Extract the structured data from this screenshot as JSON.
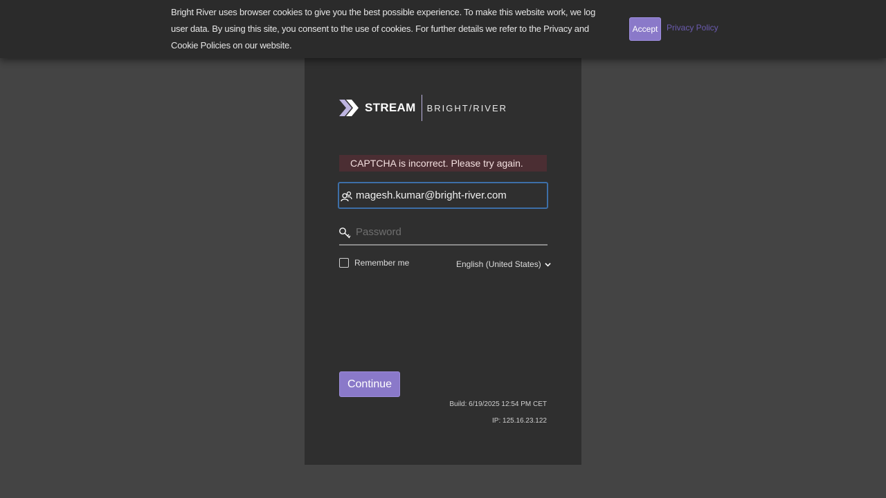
{
  "cookie_banner": {
    "text": "Bright River uses browser cookies to give you the best possible experience. To make this website work, we log user data. By using this site, you consent to the use of cookies. For further details we refer to the Privacy and Cookie Policies on our website.",
    "accept_label": "Accept",
    "privacy_label": "Privacy Policy"
  },
  "logo": {
    "stream": "STREAM",
    "company": "BRIGHT/RIVER"
  },
  "login": {
    "error_message": "CAPTCHA is incorrect. Please try again.",
    "email_value": "magesh.kumar@bright-river.com",
    "password_placeholder": "Password",
    "remember_label": "Remember me",
    "remember_checked": false,
    "language": "English (United States)",
    "continue_label": "Continue"
  },
  "footer": {
    "build": "Build: 6/19/2025 12:54 PM CET",
    "ip": "IP: 125.16.23.122"
  },
  "colors": {
    "accent": "#8a79c9",
    "error_bg": "#4b2e33",
    "focus_border": "#3d6fa8",
    "panel_bg": "#2f2f2f",
    "page_bg": "#444444"
  },
  "icons": {
    "user": "user-icon",
    "key": "key-icon",
    "chevron": "chevron-down-icon",
    "logo_mark": "stream-logo-icon"
  }
}
